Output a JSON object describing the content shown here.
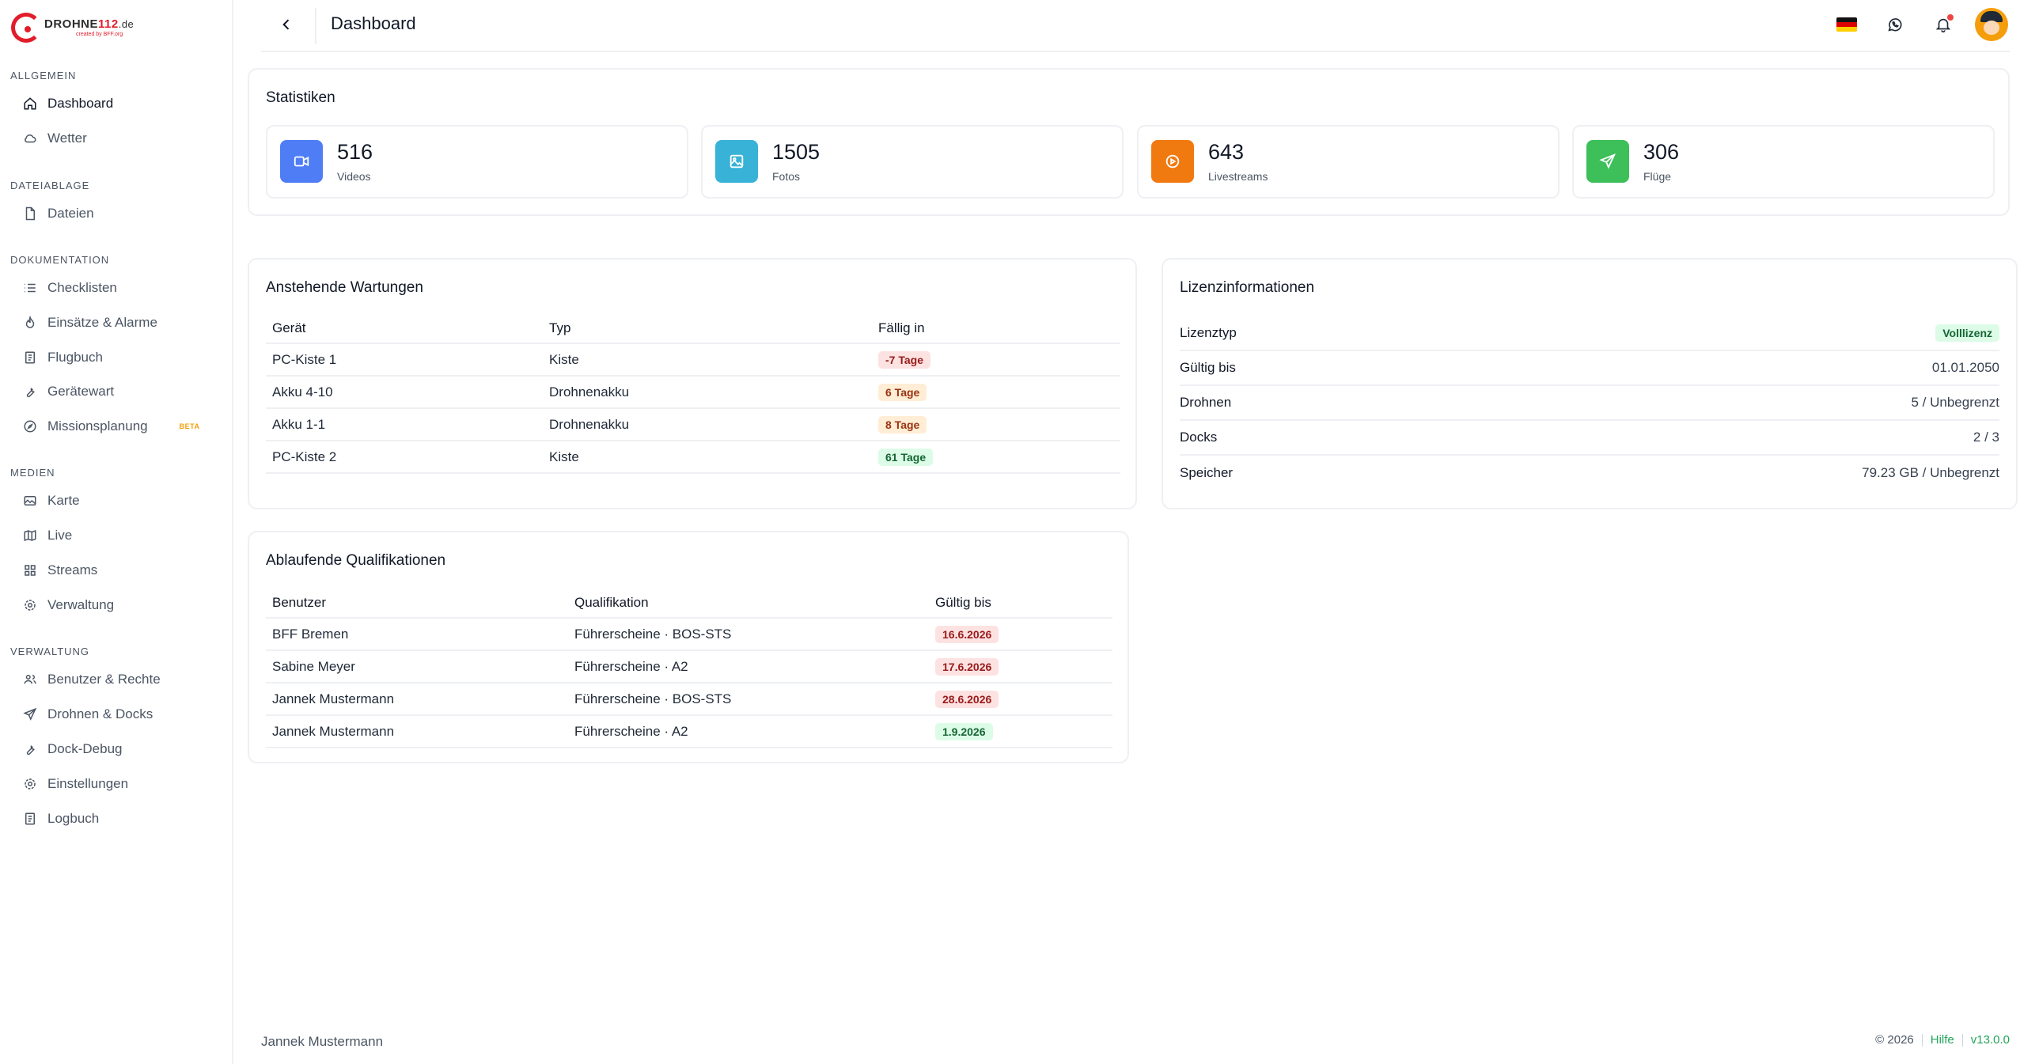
{
  "logo": {
    "brand_a": "DROHNE",
    "brand_b": "112",
    "brand_c": ".de",
    "tagline": "created by BFF.org"
  },
  "sidebar": {
    "sections": [
      {
        "title": "ALLGEMEIN",
        "items": [
          {
            "label": "Dashboard",
            "icon": "home-icon",
            "active": true
          },
          {
            "label": "Wetter",
            "icon": "cloud-icon"
          }
        ]
      },
      {
        "title": "DATEIABLAGE",
        "items": [
          {
            "label": "Dateien",
            "icon": "file-icon"
          }
        ]
      },
      {
        "title": "DOKUMENTATION",
        "items": [
          {
            "label": "Checklisten",
            "icon": "list-icon"
          },
          {
            "label": "Einsätze & Alarme",
            "icon": "fire-icon"
          },
          {
            "label": "Flugbuch",
            "icon": "book-icon"
          },
          {
            "label": "Gerätewart",
            "icon": "wrench-icon"
          },
          {
            "label": "Missionsplanung",
            "icon": "compass-icon",
            "badge": "BETA"
          }
        ]
      },
      {
        "title": "MEDIEN",
        "items": [
          {
            "label": "Karte",
            "icon": "image-icon"
          },
          {
            "label": "Live",
            "icon": "map-icon"
          },
          {
            "label": "Streams",
            "icon": "grid-icon"
          },
          {
            "label": "Verwaltung",
            "icon": "gear-icon"
          }
        ]
      },
      {
        "title": "VERWALTUNG",
        "items": [
          {
            "label": "Benutzer & Rechte",
            "icon": "users-icon"
          },
          {
            "label": "Drohnen & Docks",
            "icon": "send-icon"
          },
          {
            "label": "Dock-Debug",
            "icon": "wrench-icon"
          },
          {
            "label": "Einstellungen",
            "icon": "gear-icon"
          },
          {
            "label": "Logbuch",
            "icon": "book-icon"
          }
        ]
      }
    ]
  },
  "header": {
    "title": "Dashboard",
    "icons": [
      "flag-de-icon",
      "whatsapp-icon",
      "bell-icon",
      "avatar"
    ]
  },
  "stats": {
    "title": "Statistiken",
    "items": [
      {
        "value": "516",
        "label": "Videos",
        "color": "#4f7df5",
        "icon": "video-icon"
      },
      {
        "value": "1505",
        "label": "Fotos",
        "color": "#38b2d6",
        "icon": "photo-icon"
      },
      {
        "value": "643",
        "label": "Livestreams",
        "color": "#f17a10",
        "icon": "play-circle-icon"
      },
      {
        "value": "306",
        "label": "Flüge",
        "color": "#3dbf5a",
        "icon": "send-icon"
      }
    ]
  },
  "maintenance": {
    "title": "Anstehende Wartungen",
    "columns": [
      "Gerät",
      "Typ",
      "Fällig in"
    ],
    "rows": [
      {
        "device": "PC-Kiste 1",
        "type": "Kiste",
        "due": "-7 Tage",
        "status": "red"
      },
      {
        "device": "Akku 4-10",
        "type": "Drohnenakku",
        "due": "6 Tage",
        "status": "orange"
      },
      {
        "device": "Akku 1-1",
        "type": "Drohnenakku",
        "due": "8 Tage",
        "status": "orange"
      },
      {
        "device": "PC-Kiste 2",
        "type": "Kiste",
        "due": "61 Tage",
        "status": "green"
      }
    ]
  },
  "license": {
    "title": "Lizenzinformationen",
    "rows": [
      {
        "key": "Lizenztyp",
        "value": "Volllizenz",
        "badge": true
      },
      {
        "key": "Gültig bis",
        "value": "01.01.2050"
      },
      {
        "key": "Drohnen",
        "value": "5 / Unbegrenzt"
      },
      {
        "key": "Docks",
        "value": "2 / 3"
      },
      {
        "key": "Speicher",
        "value": "79.23 GB / Unbegrenzt"
      }
    ]
  },
  "qualifications": {
    "title": "Ablaufende Qualifikationen",
    "columns": [
      "Benutzer",
      "Qualifikation",
      "Gültig bis"
    ],
    "rows": [
      {
        "user": "BFF Bremen",
        "qualification": "Führerscheine · BOS-STS",
        "valid_until": "16.6.2026",
        "status": "red"
      },
      {
        "user": "Sabine Meyer",
        "qualification": "Führerscheine · A2",
        "valid_until": "17.6.2026",
        "status": "red"
      },
      {
        "user": "Jannek Mustermann",
        "qualification": "Führerscheine · BOS-STS",
        "valid_until": "28.6.2026",
        "status": "red"
      },
      {
        "user": "Jannek Mustermann",
        "qualification": "Führerscheine · A2",
        "valid_until": "1.9.2026",
        "status": "green"
      }
    ]
  },
  "footer": {
    "user": "Jannek Mustermann",
    "copyright": "© 2026",
    "help": "Hilfe",
    "version": "v13.0.0"
  }
}
